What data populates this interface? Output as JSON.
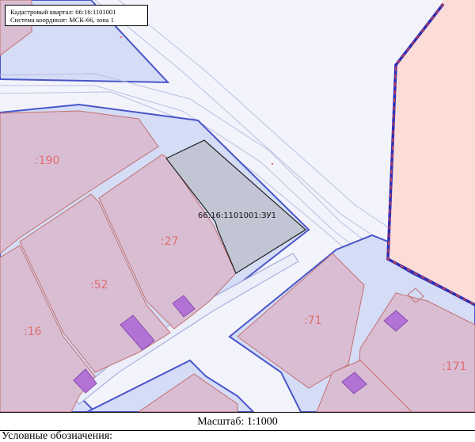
{
  "map": {
    "info": {
      "cadastral_quarter": "Кадастровый квартал: 66:16:1101001",
      "coordinate_system": "Система координат: МСК-66, зона 1"
    },
    "target_parcel_label": "66:16:1101001:ЗУ1",
    "parcel_labels": {
      "p190": ":190",
      "p27": ":27",
      "p52": ":52",
      "p16": ":16",
      "p71": ":71",
      "p171": ":171"
    },
    "colors": {
      "road_band": "#d4dcf6",
      "quarter_border": "#4a56c8",
      "parcel_fill": "#d9bdd3",
      "parcel_border": "#c4706e",
      "building_fill": "#b272d6",
      "target_fill": "#c2c6d4",
      "protected_zone_fill": "#fbdcd6",
      "protected_zone_border": "#2c2cb8",
      "protected_zone_dash": "#e04040"
    }
  },
  "footer": {
    "scale": "Масштаб: 1:1000",
    "legend_title": "Условные обозначения:"
  }
}
